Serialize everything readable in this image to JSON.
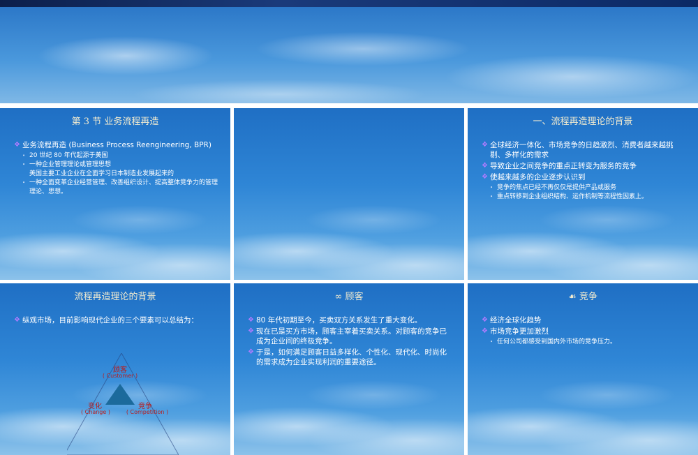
{
  "slides": [
    {
      "title": "第 3 节  业务流程再造",
      "bullets": [
        {
          "level": 1,
          "text": "业务流程再造 (Business Process Reengineering, BPR)"
        },
        {
          "level": 2,
          "text": "20 世纪 80 年代起源于美国"
        },
        {
          "level": 2,
          "text": "一种企业管理理论或管理思想"
        },
        {
          "level": 2,
          "text": "美国主要工业企业在全面学习日本制造业发展起来的",
          "nobullet": true
        },
        {
          "level": 2,
          "text": "一种全面变革企业经营管理、改善组织设计、提高整体竞争力的管理理论、思想。"
        }
      ]
    },
    {
      "title": "",
      "bullets": []
    },
    {
      "title": "一、流程再造理论的背景",
      "bullets": [
        {
          "level": 1,
          "text": "全球经济一体化、市场竞争的日趋激烈、消费者越来越挑剔、多样化的需求"
        },
        {
          "level": 1,
          "text": "导致企业之间竞争的重点正转变为服务的竞争"
        },
        {
          "level": 1,
          "text": "使越来越多的企业逐步认识到"
        },
        {
          "level": 2,
          "text": "竞争的焦点已经不再仅仅是提供产品或服务"
        },
        {
          "level": 2,
          "text": "重点转移到企业组织结构、运作机制等流程性因素上。"
        }
      ]
    },
    {
      "title": "流程再造理论的背景",
      "bullets": [
        {
          "level": 1,
          "text": "        纵观市场，目前影响现代企业的三个要素可以总结为："
        }
      ],
      "diagram": {
        "top": {
          "label": "顾客",
          "sub": "( Customer )"
        },
        "left": {
          "label": "变化",
          "sub": "( Change )"
        },
        "right": {
          "label": "竞争",
          "sub": "( Competition )"
        },
        "color": "#b81e1e",
        "fill": "#1b6a9c"
      }
    },
    {
      "title": "∞  顾客",
      "bullets": [
        {
          "level": 1,
          "text": "80 年代初期至今，买卖双方关系发生了重大变化。"
        },
        {
          "level": 1,
          "text": "现在已是买方市场，顾客主宰着买卖关系。对顾客的竞争已成为企业间的终极竞争。"
        },
        {
          "level": 1,
          "text": "于是，如何满足顾客日益多样化、个性化、现代化、时尚化的需求成为企业实现利润的重要途径。"
        }
      ]
    },
    {
      "title": "☙  竞争",
      "bullets": [
        {
          "level": 1,
          "text": "经济全球化趋势"
        },
        {
          "level": 1,
          "text": "市场竞争更加激烈"
        },
        {
          "level": 2,
          "text": "任何公司都感受到国内外市场的竞争压力。"
        }
      ]
    }
  ]
}
